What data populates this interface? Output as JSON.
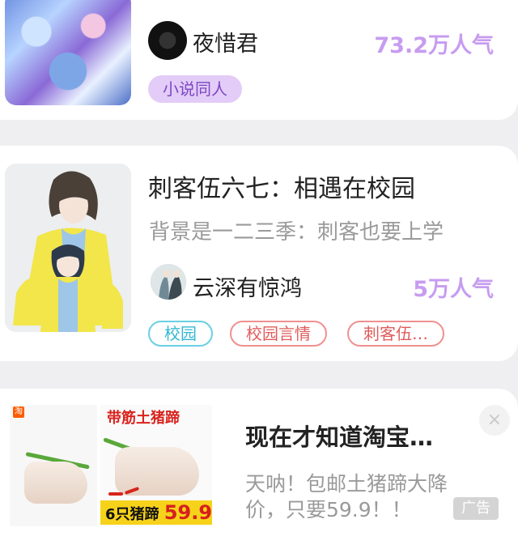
{
  "card1": {
    "author": "夜惜君",
    "popularity": "73.2万人气",
    "tag": "小说同人"
  },
  "card2": {
    "title": "刺客伍六七：相遇在校园",
    "description": "背景是一二三季：刺客也要上学",
    "author": "云深有惊鸿",
    "popularity": "5万人气",
    "tags": [
      "校园",
      "校园言情",
      "刺客伍…"
    ]
  },
  "ad": {
    "image_headline": "带筋土猪蹄",
    "image_price_prefix": "6只猪蹄",
    "image_price": "59.9",
    "title": "现在才知道淘宝…",
    "description": "天呐！包邮土猪蹄大降价，只要59.9！！",
    "badge": "广告",
    "close_icon": "×"
  },
  "colors": {
    "accent_purple": "#c79cf0",
    "tag_blue": "#35b7d2",
    "tag_red": "#e05c5c"
  }
}
